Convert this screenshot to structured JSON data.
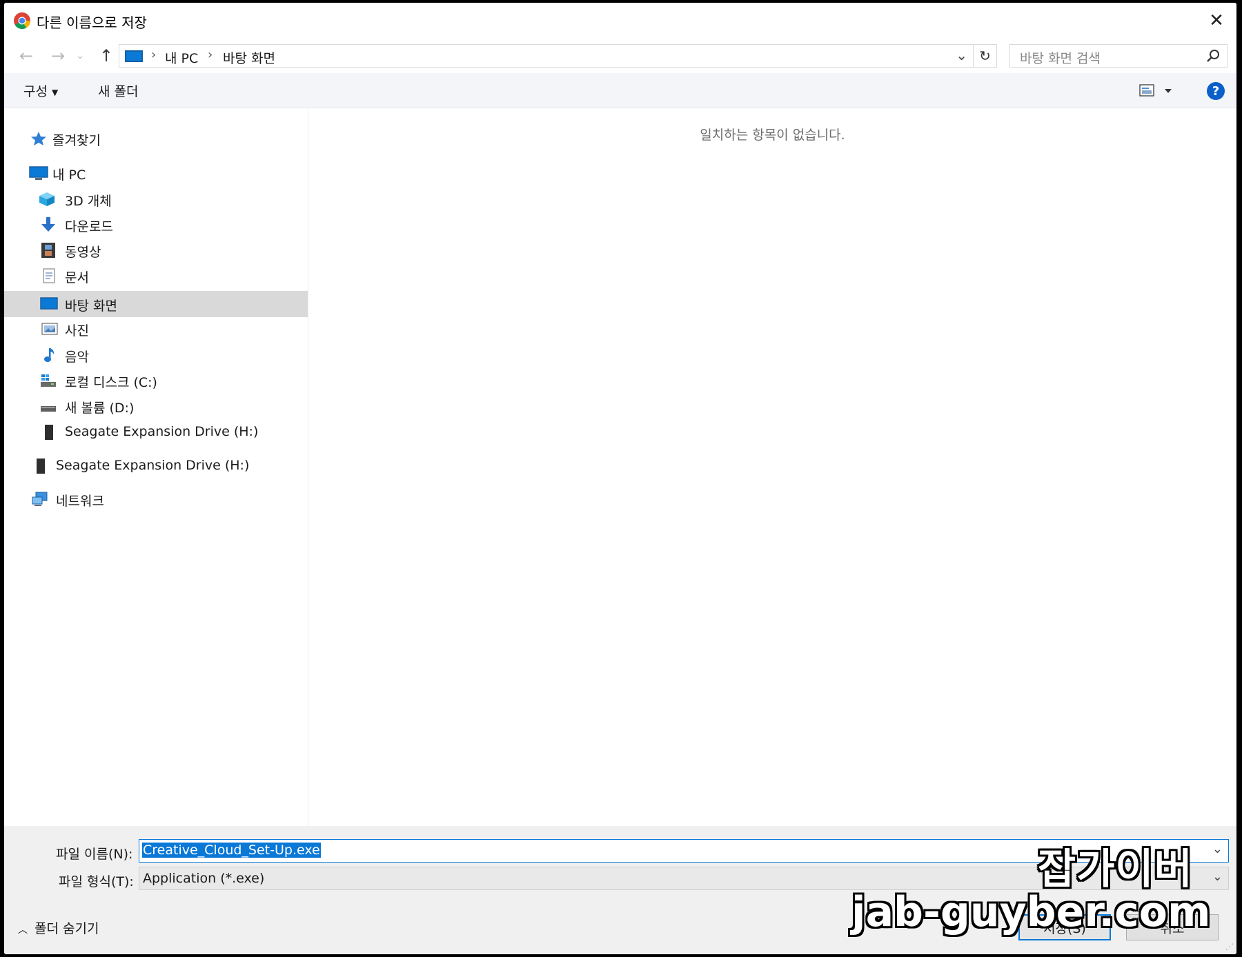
{
  "window": {
    "title": "다른 이름으로 저장",
    "close_glyph": "✕"
  },
  "address": {
    "crumbs": [
      "내 PC",
      "바탕 화면"
    ],
    "search_placeholder": "바탕 화면 검색"
  },
  "toolbar": {
    "organize": "구성",
    "new_folder": "새 폴더",
    "help": "?"
  },
  "nav": {
    "quick_access": "즐겨찾기",
    "this_pc": "내 PC",
    "objects3d": "3D 개체",
    "downloads": "다운로드",
    "videos": "동영상",
    "documents": "문서",
    "desktop": "바탕 화면",
    "pictures": "사진",
    "music": "음악",
    "local_disk": "로컬 디스크 (C:)",
    "new_volume": "새 볼륨 (D:)",
    "seagate_sub": "Seagate Expansion Drive (H:)",
    "seagate_root": "Seagate Expansion Drive (H:)",
    "network": "네트워크"
  },
  "content": {
    "empty_message": "일치하는 항목이 없습니다."
  },
  "bottom": {
    "filename_label": "파일 이름(N):",
    "filename_value": "Creative_Cloud_Set-Up.exe",
    "filetype_label": "파일 형식(T):",
    "filetype_value": "Application (*.exe)",
    "hide_folders": "폴더 숨기기",
    "save": "저장(S)",
    "cancel": "취소"
  },
  "watermark": {
    "line1": "잡가이버",
    "line2": "jab-guyber.com"
  },
  "colors": {
    "accent": "#0a78d7",
    "selection": "#d9d9d9",
    "toolbar_bg": "#f3f5f9",
    "help": "#0a5fc8"
  },
  "icons": [
    "chrome-icon",
    "close-icon",
    "back-arrow-icon",
    "forward-arrow-icon",
    "up-arrow-icon",
    "pc-icon",
    "refresh-icon",
    "search-icon",
    "view-icon",
    "help-icon",
    "star-icon",
    "cube-icon",
    "download-icon",
    "film-icon",
    "document-icon",
    "desktop-icon",
    "picture-icon",
    "music-icon",
    "disk-icon",
    "drive-icon",
    "network-icon"
  ]
}
